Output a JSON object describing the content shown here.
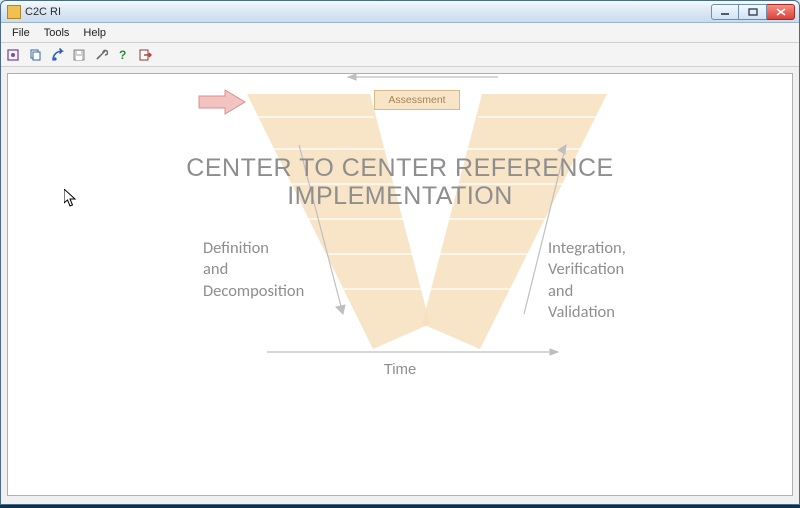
{
  "window": {
    "title": "C2C RI"
  },
  "menu": {
    "file": "File",
    "tools": "Tools",
    "help": "Help"
  },
  "toolbar": {
    "icons": [
      "new-config-icon",
      "copy-icon",
      "run-icon",
      "save-icon",
      "tools-icon",
      "help-icon",
      "exit-icon"
    ]
  },
  "diagram": {
    "title_line1": "CENTER TO CENTER REFERENCE",
    "title_line2": "IMPLEMENTATION",
    "left_label": "Definition\nand\nDecomposition",
    "right_label": "Integration,\nVerification\nand\nValidation",
    "time_label": "Time",
    "assessment": "Assessment"
  }
}
